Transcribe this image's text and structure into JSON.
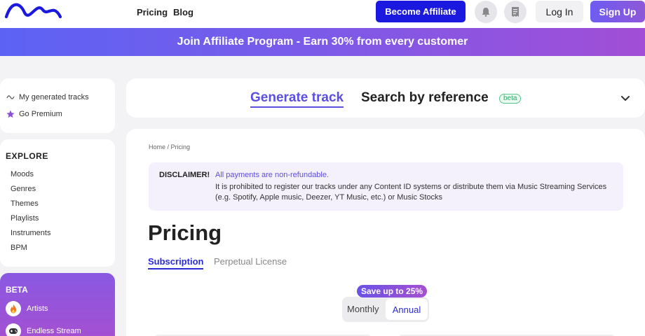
{
  "nav": {
    "links": [
      "Pricing",
      "Blog"
    ],
    "become_affiliate": "Become Affiliate",
    "login": "Log In",
    "signup": "Sign Up",
    "icons": [
      "bell-icon",
      "receipt-icon"
    ]
  },
  "banner": {
    "text": "Join Affiliate Program - Earn 30% from every customer"
  },
  "sidebar": {
    "top_items": [
      {
        "label": "My generated tracks",
        "icon": "wave-icon"
      },
      {
        "label": "Go Premium",
        "icon": "star-icon"
      }
    ],
    "explore": {
      "title": "EXPLORE",
      "items": [
        "Moods",
        "Genres",
        "Themes",
        "Playlists",
        "Instruments",
        "BPM"
      ]
    },
    "beta": {
      "title": "BETA",
      "items": [
        {
          "label": "Artists",
          "icon": "fire-icon"
        },
        {
          "label": "Endless Stream",
          "icon": "gamepad-icon"
        }
      ]
    }
  },
  "generate": {
    "tab_active": "Generate track",
    "tab_other": "Search by reference",
    "beta_pill": "beta"
  },
  "main": {
    "breadcrumb": "Home  /  Pricing",
    "disclaimer": {
      "label": "DISCLAIMER!",
      "strong": "All payments are non-refundable.",
      "text": "It is prohibited to register our tracks under any Content ID systems or distribute them via Music Streaming Services (e.g. Spotify, Apple music, Deezer, YT Music, etc.) or Music Stocks"
    },
    "title": "Pricing",
    "tabs": [
      "Subscription",
      "Perpetual License"
    ],
    "save_badge": "Save up to 25%",
    "billing": {
      "monthly": "Monthly",
      "annual": "Annual",
      "selected": "Annual"
    }
  },
  "colors": {
    "accent": "#1b19e0",
    "purple": "#5b4fe0",
    "banner_start": "#5c63f4",
    "banner_end": "#a24ed6"
  }
}
